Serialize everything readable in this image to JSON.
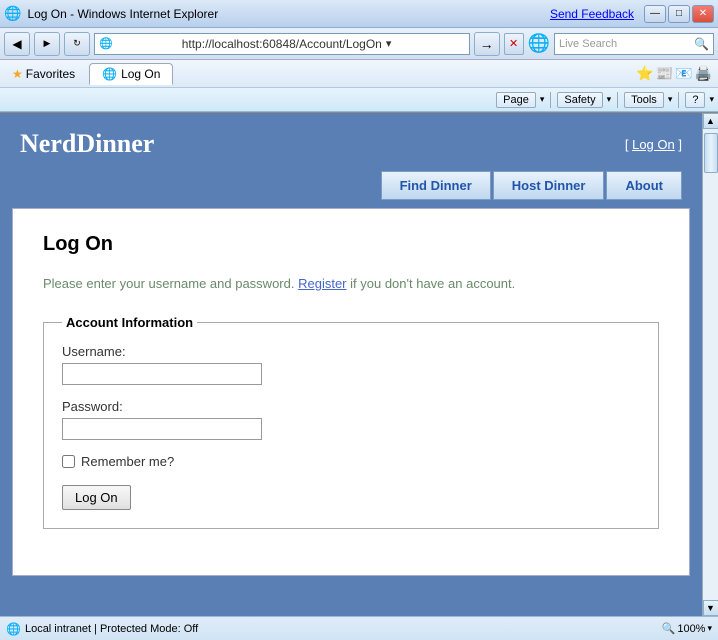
{
  "titlebar": {
    "title": "Log On - Windows Internet Explorer",
    "send_feedback": "Send Feedback",
    "controls": [
      "—",
      "□",
      "✕"
    ]
  },
  "addressbar": {
    "url": "http://localhost:60848/Account/LogOn",
    "live_search_placeholder": "Live Search"
  },
  "favoritesbar": {
    "favorites_label": "Favorites",
    "tab_label": "Log On"
  },
  "toolbar": {
    "page_label": "Page",
    "safety_label": "Safety",
    "tools_label": "Tools"
  },
  "nav": {
    "find_dinner": "Find Dinner",
    "host_dinner": "Host Dinner",
    "about": "About"
  },
  "header": {
    "logo": "NerdDinner",
    "login_bracket_open": "[ ",
    "login_link": "Log On",
    "login_bracket_close": " ]"
  },
  "form": {
    "title": "Log On",
    "intro_text": "Please enter your username and password. ",
    "register_link": "Register",
    "intro_suffix": " if you don't have an account.",
    "fieldset_legend": "Account Information",
    "username_label": "Username:",
    "password_label": "Password:",
    "remember_label": "Remember me?",
    "submit_label": "Log On"
  },
  "statusbar": {
    "zone": "Local intranet | Protected Mode: Off",
    "zoom": "100%"
  }
}
